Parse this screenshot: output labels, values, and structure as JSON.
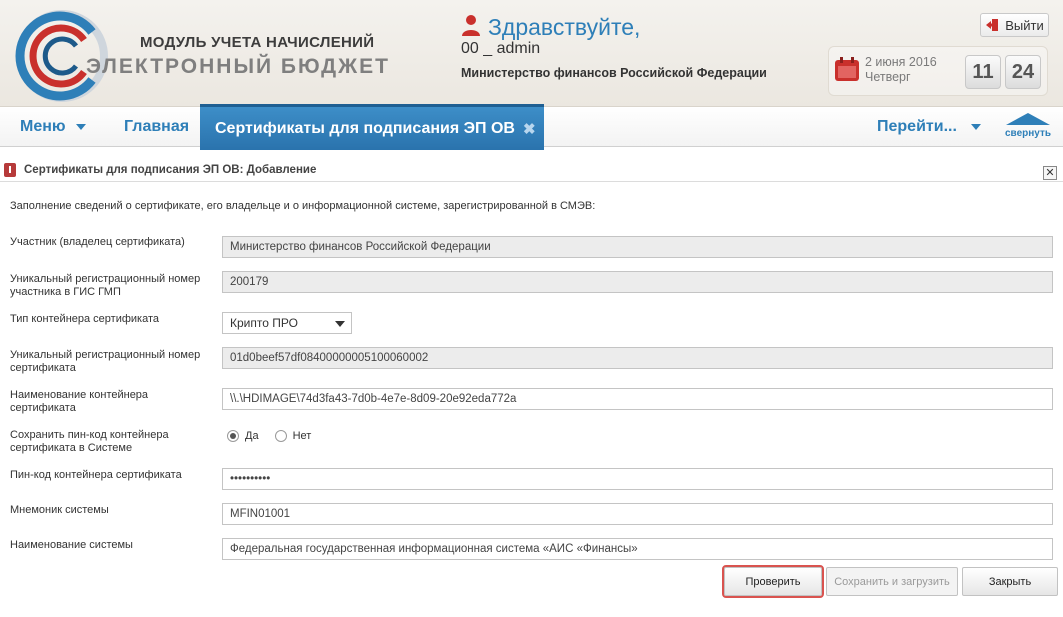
{
  "header": {
    "brand_top": "МОДУЛЬ УЧЕТА НАЧИСЛЕНИЙ",
    "brand_main": "ЭЛЕКТРОННЫЙ БЮДЖЕТ",
    "greeting": "Здравствуйте,",
    "user_name": "00 _ admin",
    "ministry": "Министерство финансов Российской Федерации",
    "logout_label": "Выйти",
    "date": "2 июня 2016",
    "weekday": "Четверг",
    "time_hours": "11",
    "time_minutes": "24"
  },
  "nav": {
    "menu_label": "Меню",
    "home_label": "Главная",
    "active_tab_label": "Сертификаты для подписания ЭП ОВ",
    "active_tab_close": "✖",
    "goto_label": "Перейти...",
    "collapse_label": "свернуть"
  },
  "panel": {
    "title": "Сертификаты для подписания ЭП ОВ: Добавление",
    "close_symbol": "✕",
    "intro": "Заполнение сведений о сертификате, его владельце и о информационной системе, зарегистрированной в СМЭВ:"
  },
  "form": {
    "participant_label": "Участник (владелец сертификата)",
    "participant_value": "Министерство финансов Российской Федерации",
    "reg_number_label": "Уникальный регистрационный номер участника в ГИС ГМП",
    "reg_number_value": "200179",
    "container_type_label": "Тип контейнера сертификата",
    "container_type_value": "Крипто ПРО",
    "cert_number_label": "Уникальный регистрационный номер сертификата",
    "cert_number_value": "01d0beef57df08400000005100060002",
    "container_name_label": "Наименование контейнера сертификата",
    "container_name_value": "\\\\.\\HDIMAGE\\74d3fa43-7d0b-4e7e-8d09-20e92eda772a",
    "save_pin_label": "Сохранить пин-код контейнера сертификата в Системе",
    "save_pin_yes": "Да",
    "save_pin_no": "Нет",
    "pin_label": "Пин-код контейнера сертификата",
    "pin_value": "••••••••••",
    "mnemonic_label": "Мнемоник системы",
    "mnemonic_value": "MFIN01001",
    "system_name_label": "Наименование системы",
    "system_name_value": "Федеральная государственная информационная система «АИС «Финансы»"
  },
  "actions": {
    "check_label": "Проверить",
    "save_label": "Сохранить и загрузить",
    "close_label": "Закрыть"
  },
  "colors": {
    "accent": "#2e7fb8",
    "active_tab": "#2a73ad",
    "highlight_border": "#d9534f",
    "icon_red": "#b63a3a"
  }
}
